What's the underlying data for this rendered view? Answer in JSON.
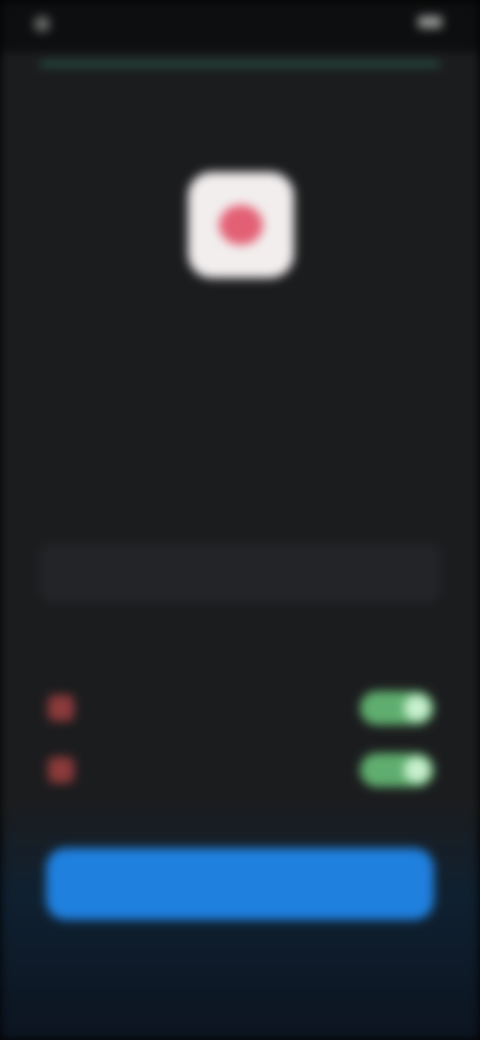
{
  "status_bar": {
    "left_text": "",
    "right_text": ""
  },
  "onboarding": {
    "progress": 1.0,
    "app_title": "",
    "heading": "",
    "description": "",
    "link_label": "",
    "permissions_caption": "",
    "permissions": [
      {
        "label": "",
        "enabled": true
      },
      {
        "label": "",
        "enabled": true
      }
    ],
    "primary_button_label": "",
    "secondary_link_label": ""
  },
  "colors": {
    "background": "#1b1c1e",
    "accent": "#1f80de",
    "toggle_on": "#5fae6e",
    "icon_red": "#e0475e"
  }
}
